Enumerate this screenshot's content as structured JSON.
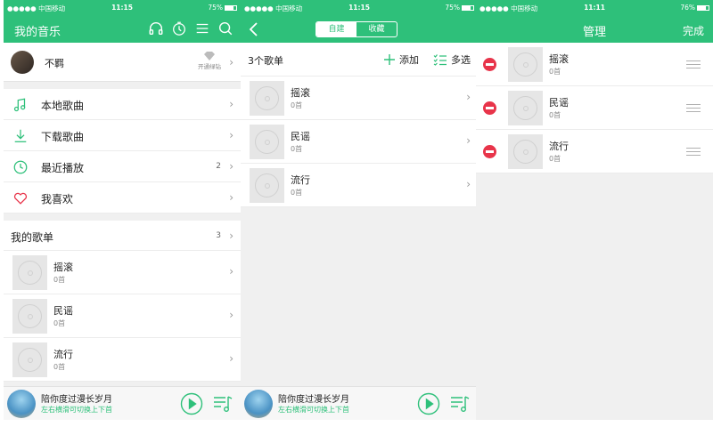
{
  "status": {
    "screens": [
      {
        "carrier": "●●●●● 中国移动",
        "time": "11:15",
        "battery": "75%"
      },
      {
        "carrier": "●●●●● 中国移动",
        "time": "11:15",
        "battery": "75%"
      },
      {
        "carrier": "●●●●● 中国移动",
        "time": "11:11",
        "battery": "76%"
      }
    ]
  },
  "screen1": {
    "title": "我的音乐",
    "header_icons": [
      "headphones-icon",
      "timer-icon",
      "menu-icon",
      "search-icon"
    ],
    "profile": {
      "name": "不羁",
      "vip_label": "开通绿钻"
    },
    "menu": [
      {
        "label": "本地歌曲",
        "icon": "music-note-icon",
        "count": ""
      },
      {
        "label": "下载歌曲",
        "icon": "download-icon",
        "count": ""
      },
      {
        "label": "最近播放",
        "icon": "clock-icon",
        "count": "2"
      },
      {
        "label": "我喜欢",
        "icon": "heart-icon",
        "count": ""
      }
    ],
    "playlists_section": {
      "title": "我的歌单",
      "count": "3"
    },
    "playlists": [
      {
        "name": "摇滚",
        "count": "0首"
      },
      {
        "name": "民谣",
        "count": "0首"
      },
      {
        "name": "流行",
        "count": "0首"
      }
    ]
  },
  "screen2": {
    "tabs": [
      "自建",
      "收藏"
    ],
    "active_tab": "自建",
    "list_title": "3个歌单",
    "add_label": "添加",
    "multi_label": "多选",
    "playlists": [
      {
        "name": "摇滚",
        "count": "0首"
      },
      {
        "name": "民谣",
        "count": "0首"
      },
      {
        "name": "流行",
        "count": "0首"
      }
    ]
  },
  "screen3": {
    "title": "管理",
    "done_label": "完成",
    "playlists": [
      {
        "name": "摇滚",
        "count": "0首"
      },
      {
        "name": "民谣",
        "count": "0首"
      },
      {
        "name": "流行",
        "count": "0首"
      }
    ]
  },
  "player": {
    "song": "陪你度过漫长岁月",
    "hint": "左右横滑可切换上下首"
  },
  "colors": {
    "brand": "#2ec07a",
    "delete": "#e8344a",
    "background": "#f0f0f0"
  }
}
